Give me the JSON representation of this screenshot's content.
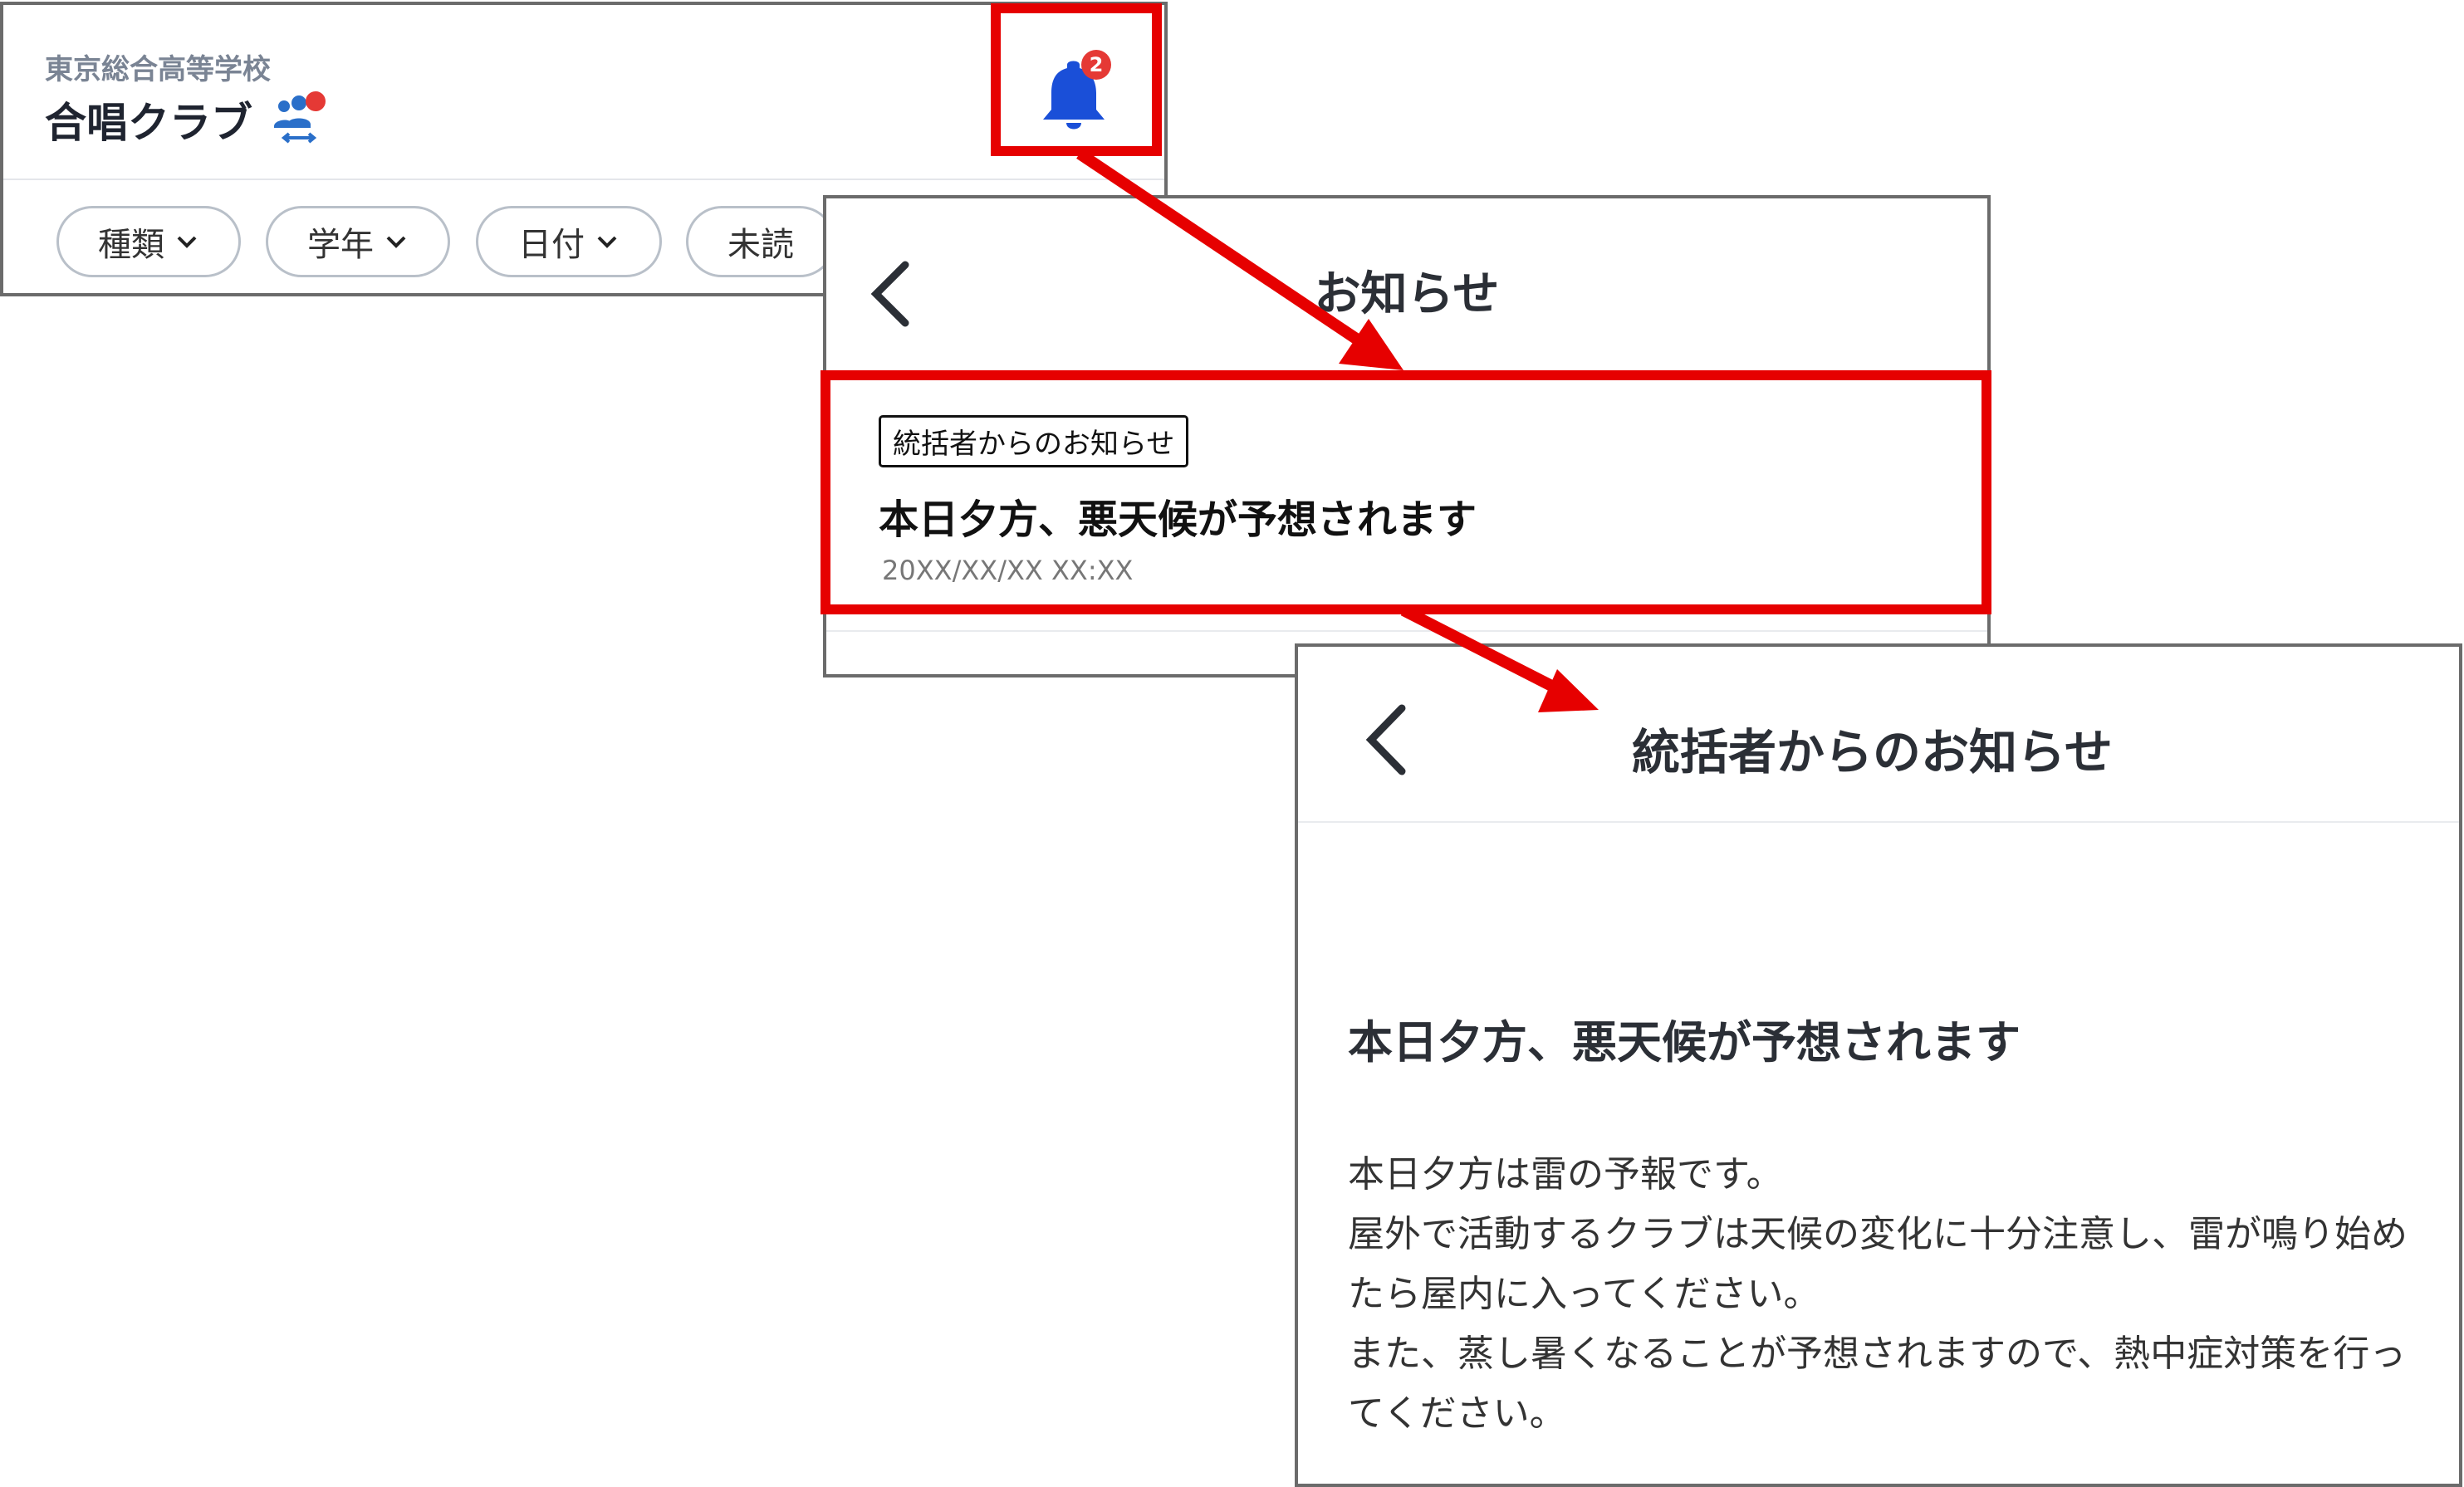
{
  "colors": {
    "highlight": "#e60000",
    "bell_blue": "#1a4fd8",
    "badge_red": "#e53935",
    "members_icon_blue": "#2a6fc9",
    "school_gray": "#7a8494"
  },
  "club_header": {
    "school_name": "東京総合高等学校",
    "club_name": "合唱クラブ",
    "notification_badge_count": "2",
    "filters": [
      {
        "label": "種類",
        "icon": "chevron-down-icon"
      },
      {
        "label": "学年",
        "icon": "chevron-down-icon"
      },
      {
        "label": "日付",
        "icon": "chevron-down-icon"
      },
      {
        "label": "未読"
      }
    ]
  },
  "notice_list": {
    "title": "お知らせ",
    "items": [
      {
        "tag": "統括者からのお知らせ",
        "headline": "本日夕方、悪天候が予想されます",
        "datetime": "20XX/XX/XX  XX:XX"
      }
    ]
  },
  "notice_detail": {
    "header_title": "統括者からのお知らせ",
    "headline": "本日夕方、悪天候が予想されます",
    "body_lines": [
      "本日夕方は雷の予報です。",
      "屋外で活動するクラブは天候の変化に十分注意し、雷が鳴り始めたら屋内に入ってください。",
      "また、蒸し暑くなることが予想されますので、熱中症対策を行ってください。"
    ]
  }
}
